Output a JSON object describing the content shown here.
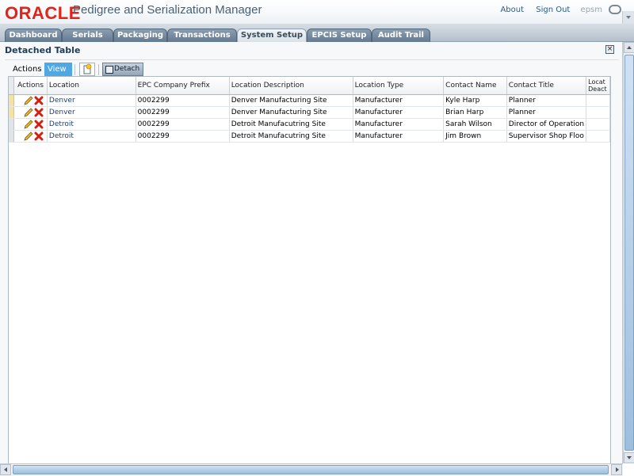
{
  "app": {
    "brand": "ORACLE",
    "title": "Pedigree and Serialization Manager",
    "links": {
      "about": "About",
      "sign_out": "Sign Out"
    },
    "user": "epsm"
  },
  "tabs": [
    {
      "label": "Dashboard",
      "active": false
    },
    {
      "label": "Serials",
      "active": false
    },
    {
      "label": "Packaging",
      "active": false
    },
    {
      "label": "Transactions",
      "active": false
    },
    {
      "label": "System Setup",
      "active": true
    },
    {
      "label": "EPCIS Setup",
      "active": false
    },
    {
      "label": "Audit Trail",
      "active": false
    }
  ],
  "panel": {
    "title": "Detached Table",
    "close_symbol": "×"
  },
  "toolbar": {
    "actions_label": "Actions",
    "view_label": "View",
    "new_icon": "new-record-icon",
    "detach_label": "Detach"
  },
  "table": {
    "columns": [
      "Actions",
      "Location",
      "EPC Company Prefix",
      "Location Description",
      "Location Type",
      "Contact Name",
      "Contact Title",
      "Locat Deact"
    ],
    "rows": [
      {
        "location": "Denver",
        "prefix": "0002299",
        "description": "Denver Manufacturing Site",
        "type": "Manufacturer",
        "contact": "Kyle Harp",
        "title": "Planner"
      },
      {
        "location": "Denver",
        "prefix": "0002299",
        "description": "Denver Manufacturing Site",
        "type": "Manufacturer",
        "contact": "Brian Harp",
        "title": "Planner"
      },
      {
        "location": "Detroit",
        "prefix": "0002299",
        "description": "Detroit Manufacutring Site",
        "type": "Manufacturer",
        "contact": "Sarah Wilson",
        "title": "Director of Operation"
      },
      {
        "location": "Detroit",
        "prefix": "0002299",
        "description": "Detroit Manufacutring Site",
        "type": "Manufacturer",
        "contact": "Jim Brown",
        "title": "Supervisor Shop Floo"
      }
    ]
  },
  "colors": {
    "brand_red": "#e2231a",
    "tab_active": "#e7ecf0",
    "tab_inactive": "#6f849a",
    "view_button": "#4fa8e6",
    "link_blue": "#1f3f78"
  }
}
